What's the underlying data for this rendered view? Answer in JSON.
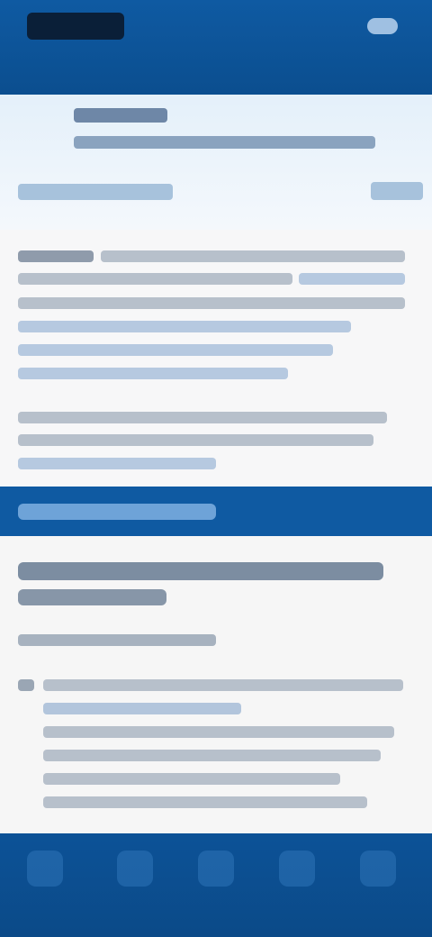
{
  "top": {
    "logo_text": ""
  },
  "header": {
    "title": "",
    "subtitle": "",
    "left_link": "",
    "right_link": ""
  },
  "content": {
    "paragraphs": []
  },
  "section": {
    "title": "",
    "heading": "",
    "intro": ""
  },
  "bottom_nav": {
    "items": []
  }
}
